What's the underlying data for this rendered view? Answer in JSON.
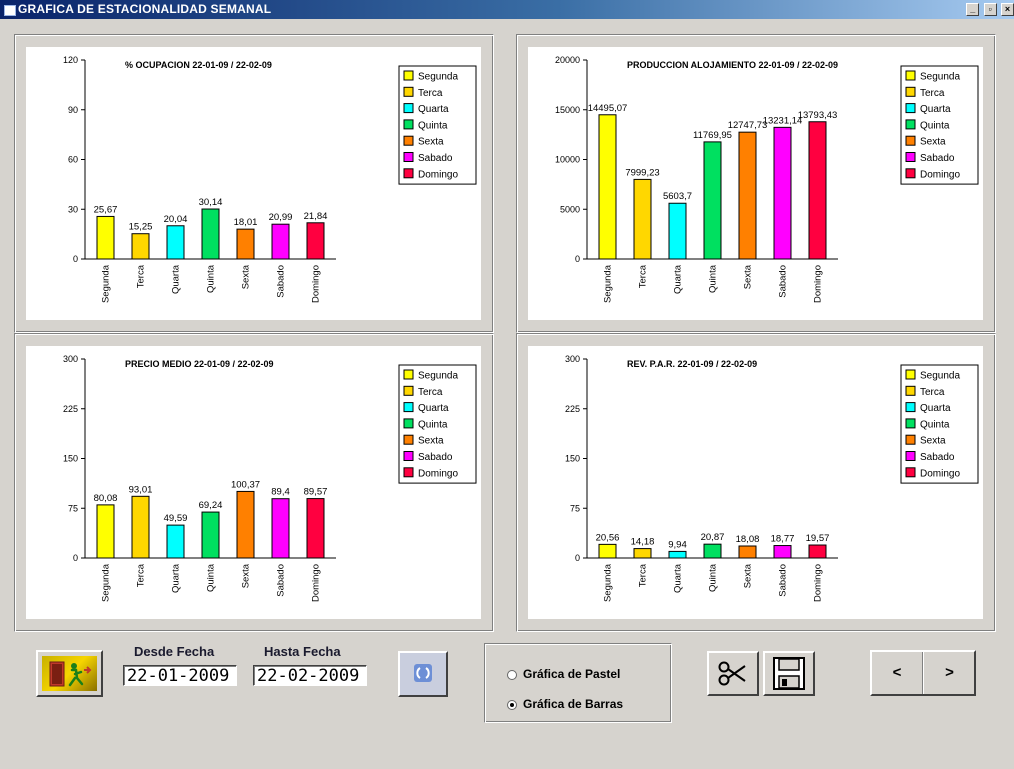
{
  "window": {
    "title": "GRAFICA DE ESTACIONALIDAD SEMANAL",
    "controls": [
      "_",
      "▫",
      "×"
    ]
  },
  "chart_data": [
    {
      "type": "bar",
      "title": "% OCUPACION  22-01-09 / 22-02-09",
      "categories": [
        "Segunda",
        "Terca",
        "Quarta",
        "Quinta",
        "Sexta",
        "Sabado",
        "Domingo"
      ],
      "values": [
        25.67,
        15.25,
        20.04,
        30.14,
        18.01,
        20.99,
        21.84
      ],
      "value_labels": [
        "25,67",
        "15,25",
        "20,04",
        "30,14",
        "18,01",
        "20,99",
        "21,84"
      ],
      "ylim": [
        0,
        120
      ],
      "yticks": [
        0,
        30,
        60,
        90,
        120
      ],
      "legend_position": "top-right"
    },
    {
      "type": "bar",
      "title": "PRODUCCION ALOJAMIENTO 22-01-09 / 22-02-09",
      "categories": [
        "Segunda",
        "Terca",
        "Quarta",
        "Quinta",
        "Sexta",
        "Sabado",
        "Domingo"
      ],
      "values": [
        14495.07,
        7999.23,
        5603.7,
        11769.95,
        12747.73,
        13231.14,
        13793.43
      ],
      "value_labels": [
        "14495,07",
        "7999,23",
        "5603,7",
        "11769,95",
        "12747,73",
        "13231,14",
        "13793,43"
      ],
      "ylim": [
        0,
        20000
      ],
      "yticks": [
        0,
        5000,
        10000,
        15000,
        20000
      ],
      "legend_position": "top-right"
    },
    {
      "type": "bar",
      "title": "PRECIO MEDIO 22-01-09 / 22-02-09",
      "categories": [
        "Segunda",
        "Terca",
        "Quarta",
        "Quinta",
        "Sexta",
        "Sabado",
        "Domingo"
      ],
      "values": [
        80.08,
        93.01,
        49.59,
        69.24,
        100.37,
        89.4,
        89.57
      ],
      "value_labels": [
        "80,08",
        "93,01",
        "49,59",
        "69,24",
        "100,37",
        "89,4",
        "89,57"
      ],
      "ylim": [
        0,
        300
      ],
      "yticks": [
        0,
        75,
        150,
        225,
        300
      ],
      "legend_position": "top-right"
    },
    {
      "type": "bar",
      "title": "REV. P.A.R.  22-01-09 / 22-02-09",
      "categories": [
        "Segunda",
        "Terca",
        "Quarta",
        "Quinta",
        "Sexta",
        "Sabado",
        "Domingo"
      ],
      "values": [
        20.56,
        14.18,
        9.94,
        20.87,
        18.08,
        18.77,
        19.57
      ],
      "value_labels": [
        "20,56",
        "14,18",
        "9,94",
        "20,87",
        "18,08",
        "18,77",
        "19,57"
      ],
      "ylim": [
        0,
        300
      ],
      "yticks": [
        0,
        75,
        150,
        225,
        300
      ],
      "legend_position": "top-right"
    }
  ],
  "series_colors": [
    "#ffff00",
    "#ffd700",
    "#00ffff",
    "#00e060",
    "#ff8000",
    "#ff00ff",
    "#ff0040"
  ],
  "controls": {
    "exit_icon": "exit-door-icon",
    "desde_label": "Desde Fecha",
    "desde_value": "22-01-2009",
    "hasta_label": "Hasta Fecha",
    "hasta_value": "22-02-2009",
    "refresh_icon": "refresh-icon",
    "radio_pastel": "Gráfica de Pastel",
    "radio_barras": "Gráfica de Barras",
    "selected_chart_type": "Gráfica de Barras",
    "cut_icon": "scissors-icon",
    "save_icon": "floppy-disk-icon",
    "prev_label": "<",
    "next_label": ">"
  }
}
